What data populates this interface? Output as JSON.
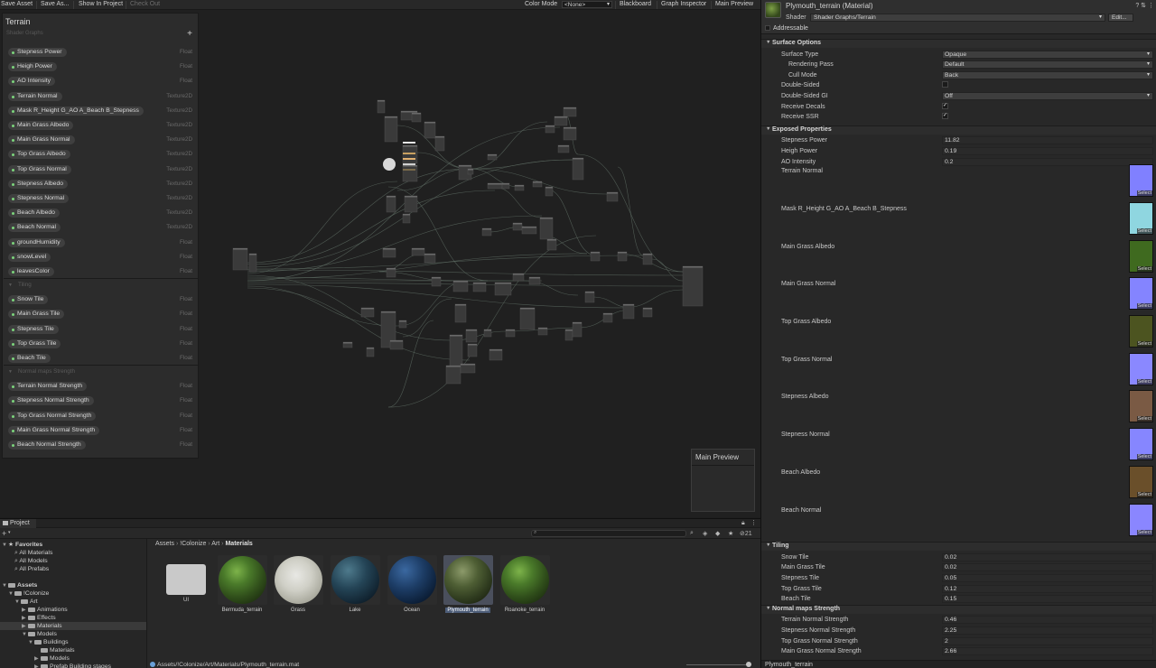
{
  "toolbar": {
    "save_asset": "Save Asset",
    "save_as": "Save As...",
    "show_in_project": "Show In Project",
    "check_out": "Check Out",
    "color_mode_label": "Color Mode",
    "color_mode_value": "<None>",
    "blackboard": "Blackboard",
    "graph_inspector": "Graph Inspector",
    "main_preview": "Main Preview"
  },
  "blackboard": {
    "title": "Terrain",
    "subtitle": "Shader Graphs",
    "add": "+",
    "properties": [
      {
        "name": "Stepness Power",
        "type": "Float"
      },
      {
        "name": "Heigh Power",
        "type": "Float"
      },
      {
        "name": "AO Intensity",
        "type": "Float"
      },
      {
        "name": "Terrain Normal",
        "type": "Texture2D"
      },
      {
        "name": "Mask R_Height G_AO A_Beach B_Stepness",
        "type": "Texture2D"
      },
      {
        "name": "Main Grass Albedo",
        "type": "Texture2D"
      },
      {
        "name": "Main Grass Normal",
        "type": "Texture2D"
      },
      {
        "name": "Top Grass Albedo",
        "type": "Texture2D"
      },
      {
        "name": "Top Grass Normal",
        "type": "Texture2D"
      },
      {
        "name": "Stepness Albedo",
        "type": "Texture2D"
      },
      {
        "name": "Stepness Normal",
        "type": "Texture2D"
      },
      {
        "name": "Beach Albedo",
        "type": "Texture2D"
      },
      {
        "name": "Beach Normal",
        "type": "Texture2D"
      },
      {
        "name": "groundHumidity",
        "type": "Float"
      },
      {
        "name": "snowLevel",
        "type": "Float"
      },
      {
        "name": "leavesColor",
        "type": "Float"
      }
    ],
    "tiling_header": "Tiling",
    "tiling": [
      {
        "name": "Snow Tile",
        "type": "Float"
      },
      {
        "name": "Main Grass Tile",
        "type": "Float"
      },
      {
        "name": "Stepness Tile",
        "type": "Float"
      },
      {
        "name": "Top Grass Tile",
        "type": "Float"
      },
      {
        "name": "Beach Tile",
        "type": "Float"
      }
    ],
    "normal_header": "Normal maps Strength",
    "normal": [
      {
        "name": "Terrain Normal Strength",
        "type": "Float"
      },
      {
        "name": "Stepness Normal Strength",
        "type": "Float"
      },
      {
        "name": "Top Grass Normal Strength",
        "type": "Float"
      },
      {
        "name": "Main Grass Normal Strength",
        "type": "Float"
      },
      {
        "name": "Beach Normal Strength",
        "type": "Float"
      }
    ]
  },
  "main_preview": {
    "title": "Main Preview"
  },
  "project": {
    "tab": "Project",
    "add": "+",
    "count": "21",
    "tree": {
      "favorites": "Favorites",
      "fav_items": [
        "All Materials",
        "All Models",
        "All Prefabs"
      ],
      "assets": "Assets",
      "colonize": "!Colonize",
      "art": "Art",
      "animations": "Animations",
      "effects": "Effects",
      "materials": "Materials",
      "models": "Models",
      "buildings": "Buildings",
      "b_materials": "Materials",
      "b_models": "Models",
      "prefab_stages": "Prefab Building stages"
    },
    "breadcrumb": [
      "Assets",
      "!Colonize",
      "Art",
      "Materials"
    ],
    "assets": [
      {
        "name": "UI",
        "kind": "folder"
      },
      {
        "name": "Bermuda_terrain",
        "kind": "grass"
      },
      {
        "name": "Grass",
        "kind": "blades"
      },
      {
        "name": "Lake",
        "kind": "lake"
      },
      {
        "name": "Ocean",
        "kind": "ocean"
      },
      {
        "name": "Plymouth_terrain",
        "kind": "terrain"
      },
      {
        "name": "Roanoke_terrain",
        "kind": "grass"
      }
    ],
    "status_path": "Assets/!Colonize/Art/Materials/Plymouth_terrain.mat"
  },
  "inspector": {
    "title": "Plymouth_terrain (Material)",
    "shader_label": "Shader",
    "shader_value": "Shader Graphs/Terrain",
    "edit": "Edit...",
    "addressable": "Addressable",
    "surface_options": "Surface Options",
    "surface": [
      {
        "label": "Surface Type",
        "value": "Opaque",
        "kind": "select"
      },
      {
        "label": "Rendering Pass",
        "value": "Default",
        "kind": "select",
        "indent": true
      },
      {
        "label": "Cull Mode",
        "value": "Back",
        "kind": "select",
        "indent": true
      },
      {
        "label": "Double-Sided",
        "value": "",
        "kind": "check"
      },
      {
        "label": "Double-Sided GI",
        "value": "Off",
        "kind": "select"
      },
      {
        "label": "Receive Decals",
        "value": "✓",
        "kind": "check"
      },
      {
        "label": "Receive SSR",
        "value": "✓",
        "kind": "check"
      }
    ],
    "exposed_properties": "Exposed Properties",
    "exposed_values": [
      {
        "label": "Stepness Power",
        "value": "11.82"
      },
      {
        "label": "Heigh Power",
        "value": "0.19"
      },
      {
        "label": "AO Intensity",
        "value": "0.2"
      }
    ],
    "textures": [
      {
        "label": "Terrain Normal",
        "color": "#8080ff"
      },
      {
        "label": "Mask R_Height G_AO A_Beach B_Stepness",
        "color": "#8fd6e0"
      },
      {
        "label": "Main Grass Albedo",
        "color": "#3f6a1f"
      },
      {
        "label": "Main Grass Normal",
        "color": "#8484ff"
      },
      {
        "label": "Top Grass Albedo",
        "color": "#4c5420"
      },
      {
        "label": "Top Grass Normal",
        "color": "#8a88ff"
      },
      {
        "label": "Stepness Albedo",
        "color": "#7a5a44"
      },
      {
        "label": "Stepness Normal",
        "color": "#8686ff"
      },
      {
        "label": "Beach Albedo",
        "color": "#6a4f2a"
      },
      {
        "label": "Beach Normal",
        "color": "#8a86ff"
      }
    ],
    "select_label": "Select",
    "tiling_header": "Tiling",
    "tiling": [
      {
        "label": "Snow Tile",
        "value": "0.02"
      },
      {
        "label": "Main Grass Tile",
        "value": "0.02"
      },
      {
        "label": "Stepness Tile",
        "value": "0.05"
      },
      {
        "label": "Top Grass Tile",
        "value": "0.12"
      },
      {
        "label": "Beach Tile",
        "value": "0.15"
      }
    ],
    "normal_header": "Normal maps Strength",
    "normal": [
      {
        "label": "Terrain Normal Strength",
        "value": "0.46"
      },
      {
        "label": "Stepness Normal Strength",
        "value": "2.25"
      },
      {
        "label": "Top Grass Normal Strength",
        "value": "2"
      },
      {
        "label": "Main Grass Normal Strength",
        "value": "2.66"
      }
    ],
    "footer": "Plymouth_terrain"
  }
}
